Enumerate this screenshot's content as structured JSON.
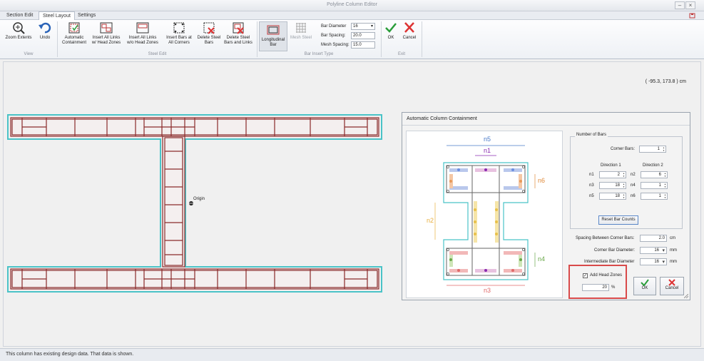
{
  "window": {
    "title": "Polyline Column Editor"
  },
  "tabs": [
    {
      "label": "Section Edit"
    },
    {
      "label": "Steel Layout"
    },
    {
      "label": "Settings"
    }
  ],
  "ribbon": {
    "view": {
      "label": "View",
      "zoom_extents": "Zoom Extents",
      "undo": "Undo"
    },
    "steel_edit": {
      "label": "Steel Edit",
      "automatic_containment": "Automatic Containment",
      "insert_all_links_head": "Insert All Links w/ Head Zones",
      "insert_all_links_nohead": "Insert All Links w/o Head Zones",
      "insert_bars_corners": "Insert Bars at All Corners",
      "delete_steel_bars": "Delete Steel Bars",
      "delete_steel_bars_links": "Delete Steel Bars and Links"
    },
    "bar_insert": {
      "label": "Bar Insert Type",
      "longitudinal_bar": "Longitudinal Bar",
      "mesh_steel": "Mesh Steel",
      "bar_diameter_label": "Bar Diameter",
      "bar_diameter_value": "16",
      "bar_spacing_label": "Bar Spacing:",
      "bar_spacing_value": "20.0",
      "mesh_spacing_label": "Mesh Spacing:",
      "mesh_spacing_value": "15.0"
    },
    "exit": {
      "label": "Exit",
      "ok": "OK",
      "cancel": "Cancel"
    }
  },
  "canvas": {
    "coordinates": "( -95.3, 173.8 ) cm",
    "origin_label": "Origin"
  },
  "status": {
    "text": "This column has existing design data. That data is shown."
  },
  "dialog": {
    "title": "Automatic Column Containment",
    "diagram": {
      "n1": "n1",
      "n2": "n2",
      "n3": "n3",
      "n4": "n4",
      "n5": "n5",
      "n6": "n6"
    },
    "number_of_bars": "Number of Bars",
    "corner_bars_label": "Corner Bars:",
    "corner_bars_value": "1",
    "direction1": "Direction 1",
    "direction2": "Direction 2",
    "n1": {
      "label": "n1",
      "value": "2"
    },
    "n2": {
      "label": "n2",
      "value": "6"
    },
    "n3": {
      "label": "n3",
      "value": "18"
    },
    "n4": {
      "label": "n4",
      "value": "1"
    },
    "n5": {
      "label": "n5",
      "value": "18"
    },
    "n6": {
      "label": "n6",
      "value": "1"
    },
    "reset": "Reset Bar Counts",
    "spacing_label": "Spacing Between Corner Bars:",
    "spacing_value": "2.0",
    "spacing_unit": "cm",
    "corner_diam_label": "Corner Bar Diameter:",
    "corner_diam_value": "16",
    "corner_diam_unit": "mm",
    "inter_diam_label": "Intermediate Bar Diameter",
    "inter_diam_value": "16",
    "inter_diam_unit": "mm",
    "add_head_zones": "Add Head Zones",
    "head_zone_value": "20",
    "head_zone_unit": "%",
    "ok": "OK",
    "cancel": "Cancel"
  }
}
